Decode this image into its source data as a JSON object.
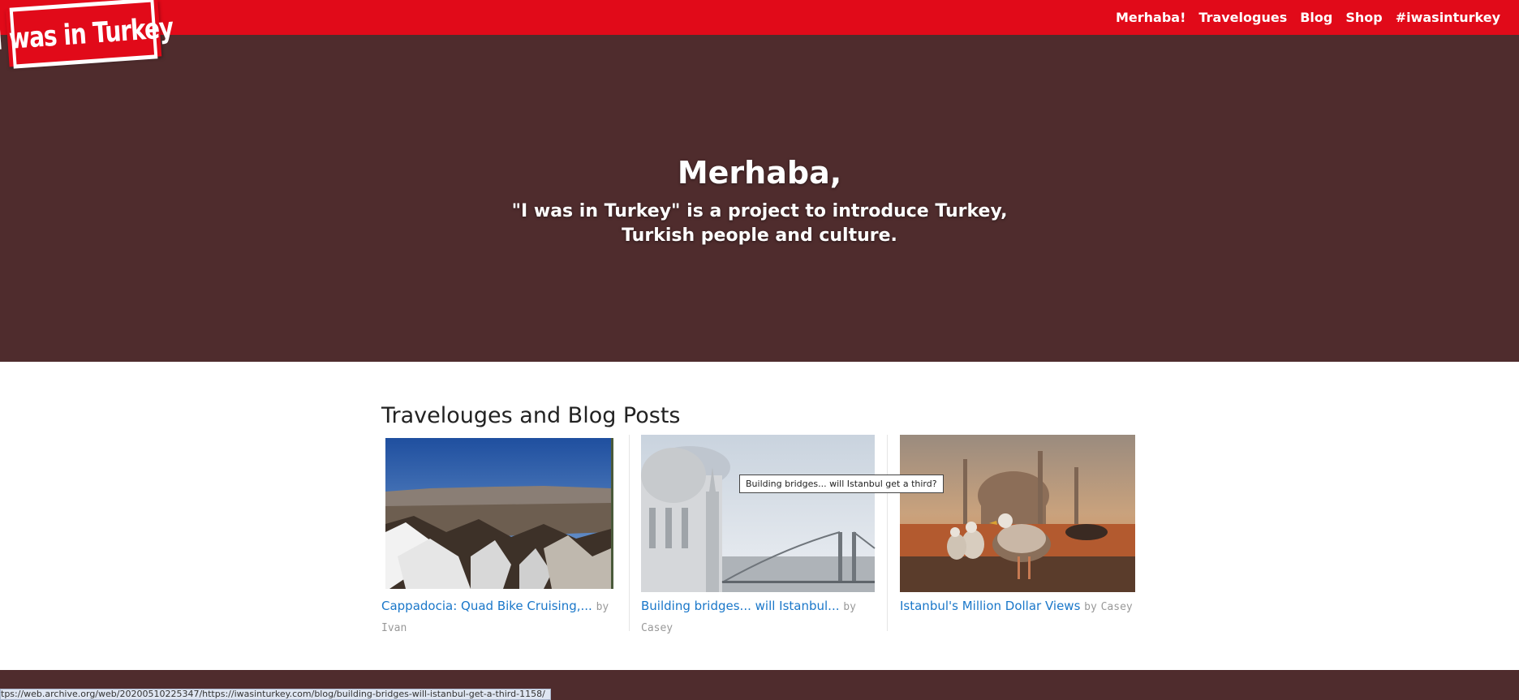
{
  "brand": {
    "logo_text": "I was in Turkey"
  },
  "nav": {
    "items": [
      "Merhaba!",
      "Travelogues",
      "Blog",
      "Shop",
      "#iwasinturkey"
    ]
  },
  "hero": {
    "title": "Merhaba,",
    "subtitle_line1": "\"I was in Turkey\" is a project to introduce Turkey,",
    "subtitle_line2": "Turkish people and culture."
  },
  "section": {
    "title": "Travelouges and Blog Posts"
  },
  "posts": [
    {
      "title": "Cappadocia: Quad Bike Cruising,...",
      "by": "by",
      "author": "Ivan"
    },
    {
      "title": "Building bridges... will Istanbul...",
      "by": "by",
      "author": "Casey"
    },
    {
      "title": "Istanbul's Million Dollar Views",
      "by": "by",
      "author": "Casey"
    }
  ],
  "tooltip": {
    "text": "Building bridges... will Istanbul get a third?"
  },
  "statusbar": {
    "url": "tps://web.archive.org/web/20200510225347/https://iwasinturkey.com/blog/building-bridges-will-istanbul-get-a-third-1158/"
  },
  "colors": {
    "brand_red": "#e10a19",
    "hero_brown": "#4f2c2d",
    "link_blue": "#1a77c9"
  }
}
